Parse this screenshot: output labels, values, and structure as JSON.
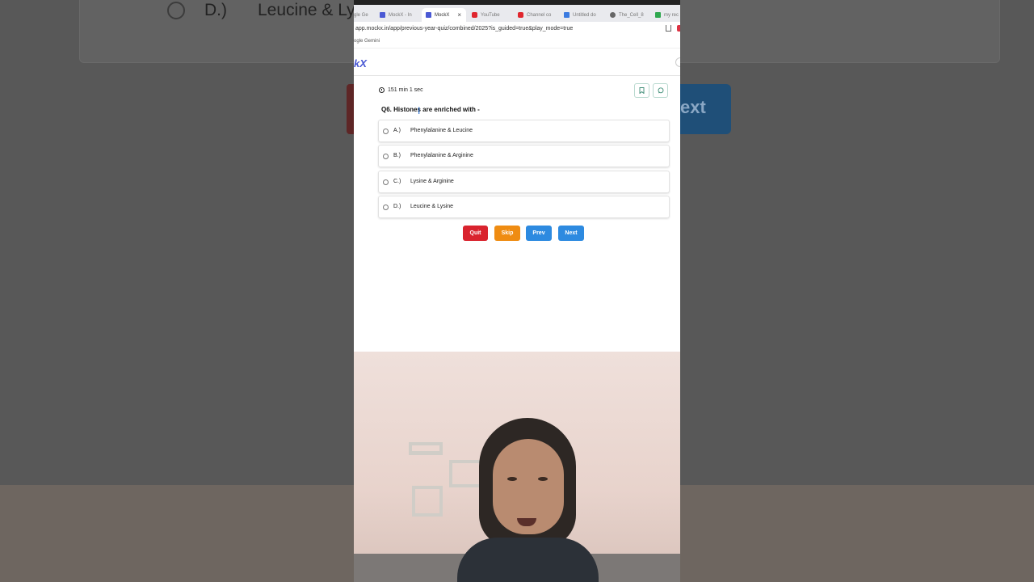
{
  "background": {
    "option_letter": "D.)",
    "option_text": "Leucine & Lysine",
    "next_fragment": "ext"
  },
  "browser": {
    "tabs": [
      {
        "label": "gle Ge",
        "icon_color": "#7b8cde"
      },
      {
        "label": "MockX - In",
        "icon_color": "#4a59d4"
      },
      {
        "label": "MockX",
        "icon_color": "#4a59d4",
        "active": true
      },
      {
        "label": "YouTube",
        "icon_color": "#e0262e"
      },
      {
        "label": "Channel co",
        "icon_color": "#e0262e"
      },
      {
        "label": "Untitled do",
        "icon_color": "#3b7be0"
      },
      {
        "label": "The_Cell_8",
        "icon_color": "#555555"
      },
      {
        "label": "my rec",
        "icon_color": "#2fa84f"
      }
    ],
    "url": "app.mockx.in/app/previous-year-quiz/combined/2025?is_guided=true&play_mode=true",
    "bookmark": "ogle Gemini"
  },
  "app": {
    "logo": "kX",
    "timer": "151 min 1 sec",
    "question": "Q6. Histones are enriched with -",
    "options": [
      {
        "letter": "A.)",
        "text": "Phenylalanine & Leucine"
      },
      {
        "letter": "B.)",
        "text": "Phenylalanine & Arginine"
      },
      {
        "letter": "C.)",
        "text": "Lysine & Arginine"
      },
      {
        "letter": "D.)",
        "text": "Leucine & Lysine"
      }
    ],
    "buttons": {
      "quit": "Quit",
      "skip": "Skip",
      "prev": "Prev",
      "next": "Next"
    }
  },
  "colors": {
    "quit": "#d9232e",
    "skip": "#ef8c12",
    "prev": "#2d8ae0",
    "next": "#2d8ae0",
    "accent": "#4a59d4"
  }
}
